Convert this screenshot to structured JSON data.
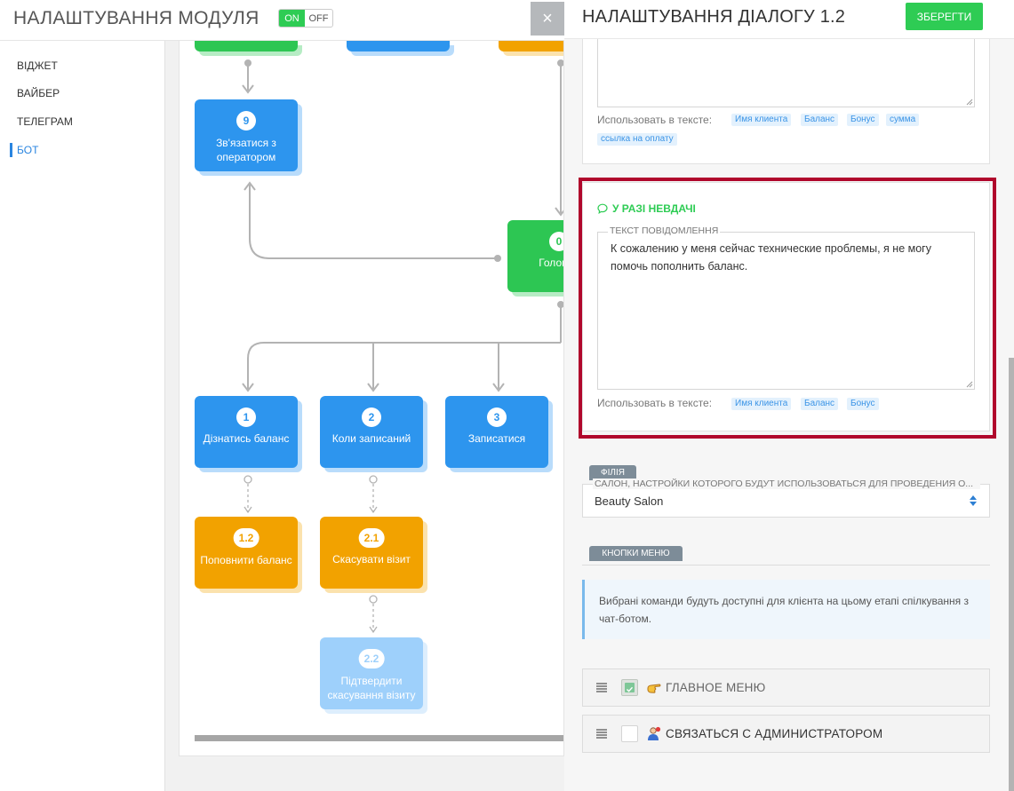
{
  "header": {
    "module_title": "НАЛАШТУВАННЯ МОДУЛЯ",
    "toggle_on": "ON",
    "toggle_off": "OFF",
    "close_glyph": "×"
  },
  "sidebar": {
    "items": [
      {
        "label": "ВІДЖЕТ"
      },
      {
        "label": "ВАЙБЕР"
      },
      {
        "label": "ТЕЛЕГРАМ"
      },
      {
        "label": "БОТ",
        "active": true
      }
    ]
  },
  "flow": {
    "nodes": [
      {
        "id": "9",
        "label": "Зв'язатися з оператором",
        "color": "blue"
      },
      {
        "id": "0",
        "label": "Головне",
        "color": "green"
      },
      {
        "id": "1",
        "label": "Дізнатись баланс",
        "color": "blue"
      },
      {
        "id": "2",
        "label": "Коли записаний",
        "color": "blue"
      },
      {
        "id": "3",
        "label": "Записатися",
        "color": "blue"
      },
      {
        "id": "1.2",
        "label": "Поповнити баланс",
        "color": "orange"
      },
      {
        "id": "2.1",
        "label": "Скасувати візит",
        "color": "orange"
      },
      {
        "id": "2.2",
        "label": "Підтвердити скасування візиту",
        "color": "lightblue"
      }
    ]
  },
  "dialog": {
    "title": "НАЛАШТУВАННЯ ДІАЛОГУ 1.2",
    "save_label": "ЗБЕРЕГТИ",
    "top_block": {
      "use_in_text_label": "Использовать в тексте:",
      "tags": [
        "Имя клиента",
        "Баланс",
        "Бонус",
        "сумма",
        "ссылка на оплату"
      ]
    },
    "failure_block": {
      "title": "У РАЗІ НЕВДАЧІ",
      "field_label": "ТЕКСТ ПОВІДОМЛЕННЯ",
      "message": "К сожалению у меня сейчас технические проблемы, я не могу помочь пополнить баланс.",
      "use_in_text_label": "Использовать в тексте:",
      "tags": [
        "Имя клиента",
        "Баланс",
        "Бонус"
      ]
    },
    "branch": {
      "tab_label": "ФІЛІЯ",
      "select_label": "САЛОН, НАСТРОЙКИ КОТОРОГО БУДУТ ИСПОЛЬЗОВАТЬСЯ ДЛЯ ПРОВЕДЕНИЯ О...",
      "selected": "Beauty Salon"
    },
    "menu_buttons": {
      "tab_label": "КНОПКИ МЕНЮ",
      "info": "Вибрані команди будуть доступні для клієнта на цьому етапі спілкування з чат-ботом.",
      "items": [
        {
          "label": "ГЛАВНОЕ МЕНЮ",
          "checked": true,
          "icon": "pointing-hand-icon"
        },
        {
          "label": "СВЯЗАТЬСЯ С АДМИНИСТРАТОРОМ",
          "checked": false,
          "icon": "admin-contact-icon"
        }
      ]
    }
  },
  "colors": {
    "blue": "#2d95ee",
    "green": "#2ecc54",
    "orange": "#f2a200",
    "light_blue": "#9ed0fb",
    "highlight_frame": "#b0072c"
  }
}
